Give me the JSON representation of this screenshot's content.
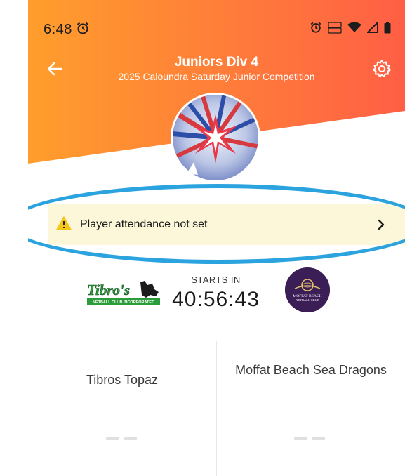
{
  "status_bar": {
    "time": "6:48",
    "icons": [
      "alarm-icon",
      "volte-icon",
      "wifi-icon",
      "signal-icon",
      "battery-icon"
    ]
  },
  "header": {
    "title": "Juniors Div 4",
    "subtitle": "2025 Caloundra Saturday Junior Competition",
    "gradient": [
      "#ff9e2c",
      "#ff5f45"
    ]
  },
  "alert": {
    "text": "Player attendance not set",
    "icon": "warning-icon",
    "background": "#fdf7d9",
    "highlight_color": "#2aa3de"
  },
  "match": {
    "starts_label": "STARTS IN",
    "countdown": "40:56:43",
    "home_logo_text": "Tibro's",
    "home_logo_subtext": "NETBALL CLUB INCORPORATED",
    "away_logo_text": "MOFFAT BEACH",
    "away_logo_subtext": "NETBALL CLUB"
  },
  "teams": {
    "home": {
      "name": "Tibros Topaz",
      "score": "– –"
    },
    "away": {
      "name": "Moffat Beach Sea Dragons",
      "score": "– –"
    }
  }
}
